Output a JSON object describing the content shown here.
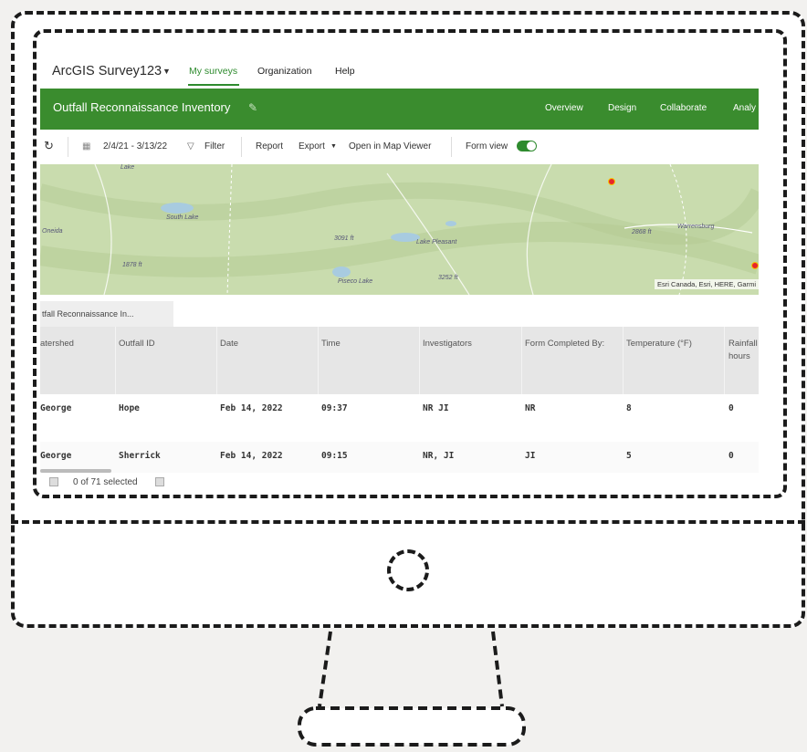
{
  "app": {
    "title": "ArcGIS Survey123"
  },
  "topnav": {
    "items": [
      "My surveys",
      "Organization",
      "Help"
    ],
    "active": "My surveys"
  },
  "survey": {
    "title": "Outfall Reconnaissance Inventory"
  },
  "tabs": [
    "Overview",
    "Design",
    "Collaborate",
    "Analy"
  ],
  "toolbar": {
    "date_range": "2/4/21 - 3/13/22",
    "filter": "Filter",
    "report": "Report",
    "export": "Export",
    "open_map": "Open in Map Viewer",
    "form_view": "Form view"
  },
  "map": {
    "attribution": "Esri Canada, Esri, HERE, Garmi",
    "labels": [
      "Lake",
      "South Lake",
      "3091 ft",
      "Lake Pleasant",
      "2868 ft",
      "Warrensburg",
      "1878 ft",
      "Piseco Lake",
      "3252 ft",
      "Oneida"
    ]
  },
  "layer_tab": "tfall Reconnaissance In...",
  "table": {
    "columns": [
      "atershed",
      "Outfall ID",
      "Date",
      "Time",
      "Investigators",
      "Form Completed By:",
      "Temperature (°F)",
      "Rainfall hours"
    ],
    "rows": [
      [
        "George",
        "Hope",
        "Feb 14, 2022",
        "09:37",
        "NR JI",
        "NR",
        "8",
        "0"
      ],
      [
        "George",
        "Sherrick",
        "Feb 14, 2022",
        "09:15",
        "NR, JI",
        "JI",
        "5",
        "0"
      ]
    ]
  },
  "footer": {
    "selected": "0 of 71 selected"
  },
  "colors": {
    "brand_green": "#3a8c2e",
    "active_link": "#2e8b2e"
  }
}
